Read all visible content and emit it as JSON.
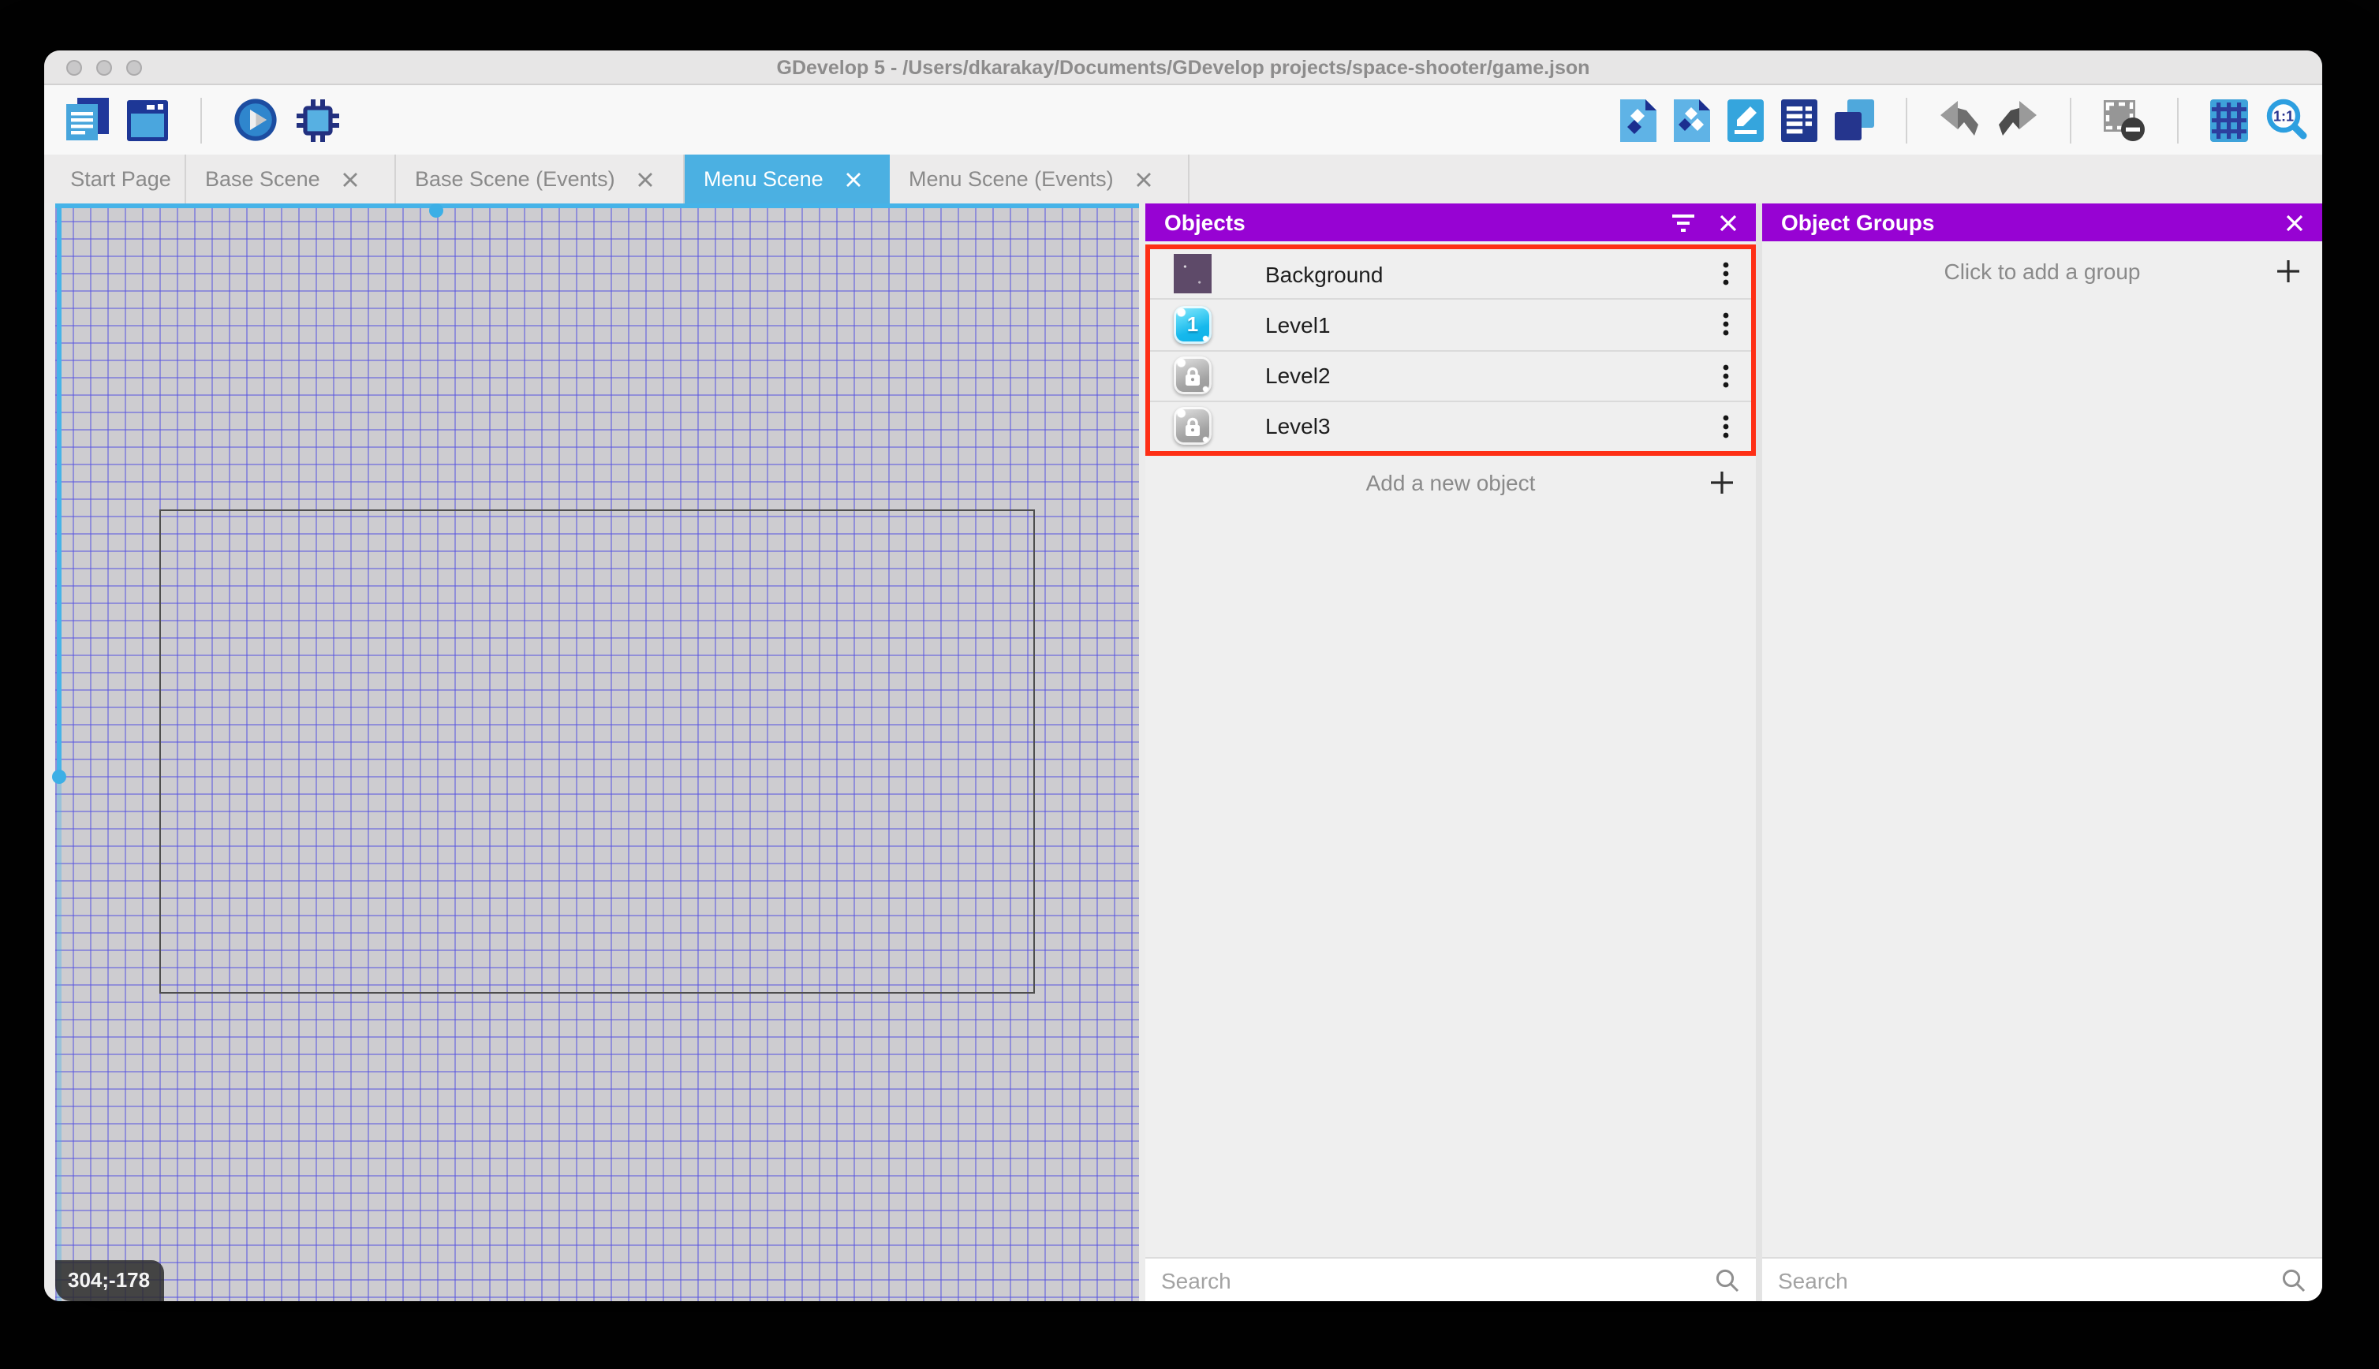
{
  "window": {
    "title": "GDevelop 5 - /Users/dkarakay/Documents/GDevelop projects/space-shooter/game.json"
  },
  "toolbar": {
    "left_icons": [
      "project-manager",
      "start-page",
      "preview-play",
      "debug"
    ],
    "right_icons": [
      "objects-editor",
      "object-groups-editor",
      "properties",
      "instances-list",
      "layers",
      "undo",
      "redo",
      "toggle-window-mask",
      "toggle-grid",
      "zoom-options"
    ],
    "zoom_icon_label": "1:1"
  },
  "tabs": [
    {
      "label": "Start Page",
      "closable": false,
      "active": false
    },
    {
      "label": "Base Scene",
      "closable": true,
      "active": false
    },
    {
      "label": "Base Scene (Events)",
      "closable": true,
      "active": false
    },
    {
      "label": "Menu Scene",
      "closable": true,
      "active": true
    },
    {
      "label": "Menu Scene (Events)",
      "closable": true,
      "active": false
    }
  ],
  "canvas": {
    "coordinate_badge": "304;-178"
  },
  "objects_panel": {
    "title": "Objects",
    "items": [
      {
        "label": "Background",
        "icon": "space-background-thumbnail"
      },
      {
        "label": "Level1",
        "icon": "level1-button",
        "icon_glyph": "1"
      },
      {
        "label": "Level2",
        "icon": "locked-button"
      },
      {
        "label": "Level3",
        "icon": "locked-button"
      }
    ],
    "add_button_label": "Add a new object",
    "search_placeholder": "Search"
  },
  "object_groups_panel": {
    "title": "Object Groups",
    "empty_button_label": "Click to add a group",
    "search_placeholder": "Search"
  },
  "colors": {
    "panel_header_purple": "#9703d3",
    "active_tab_blue": "#4bb0e2",
    "selection_cyan": "#46b3e8",
    "highlight_red": "#fe2f15",
    "grid_line": "#5652e0",
    "canvas_background": "#cdccd0"
  }
}
